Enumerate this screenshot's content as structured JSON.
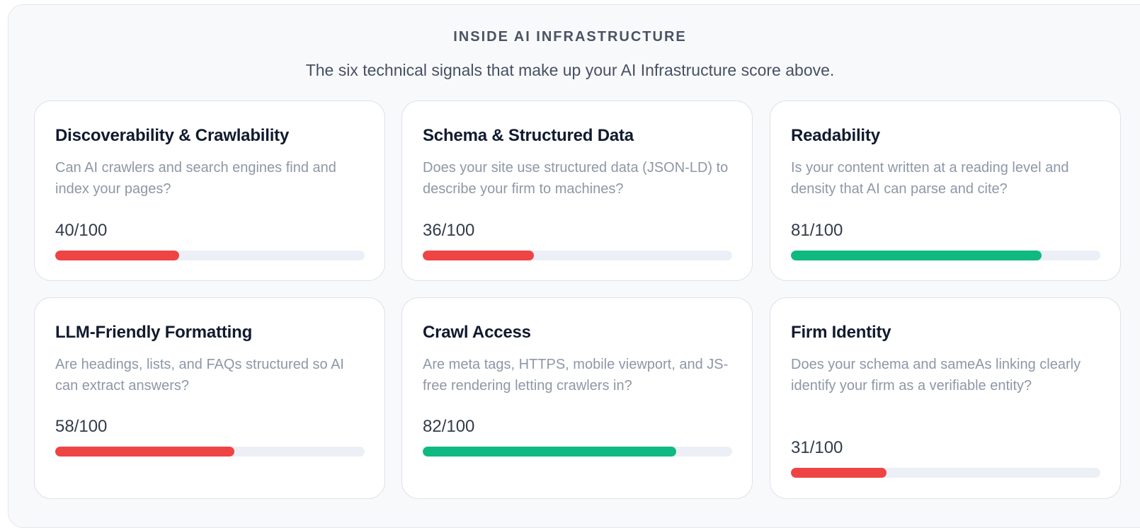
{
  "section": {
    "eyebrow": "INSIDE AI INFRASTRUCTURE",
    "subtitle": "The six technical signals that make up your AI Infrastructure score above."
  },
  "colors": {
    "low": "#ef4444",
    "high": "#10b981"
  },
  "cards": [
    {
      "title": "Discoverability & Crawlability",
      "description": "Can AI crawlers and search engines find and index your pages?",
      "score_text": "40/100",
      "score": 40,
      "status": "low"
    },
    {
      "title": "Schema & Structured Data",
      "description": "Does your site use structured data (JSON-LD) to describe your firm to machines?",
      "score_text": "36/100",
      "score": 36,
      "status": "low"
    },
    {
      "title": "Readability",
      "description": "Is your content written at a reading level and density that AI can parse and cite?",
      "score_text": "81/100",
      "score": 81,
      "status": "high"
    },
    {
      "title": "LLM-Friendly Formatting",
      "description": "Are headings, lists, and FAQs structured so AI can extract answers?",
      "score_text": "58/100",
      "score": 58,
      "status": "low"
    },
    {
      "title": "Crawl Access",
      "description": "Are meta tags, HTTPS, mobile viewport, and JS-free rendering letting crawlers in?",
      "score_text": "82/100",
      "score": 82,
      "status": "high"
    },
    {
      "title": "Firm Identity",
      "description": "Does your schema and sameAs linking clearly identify your firm as a verifiable entity?",
      "score_text": "31/100",
      "score": 31,
      "status": "low"
    }
  ]
}
